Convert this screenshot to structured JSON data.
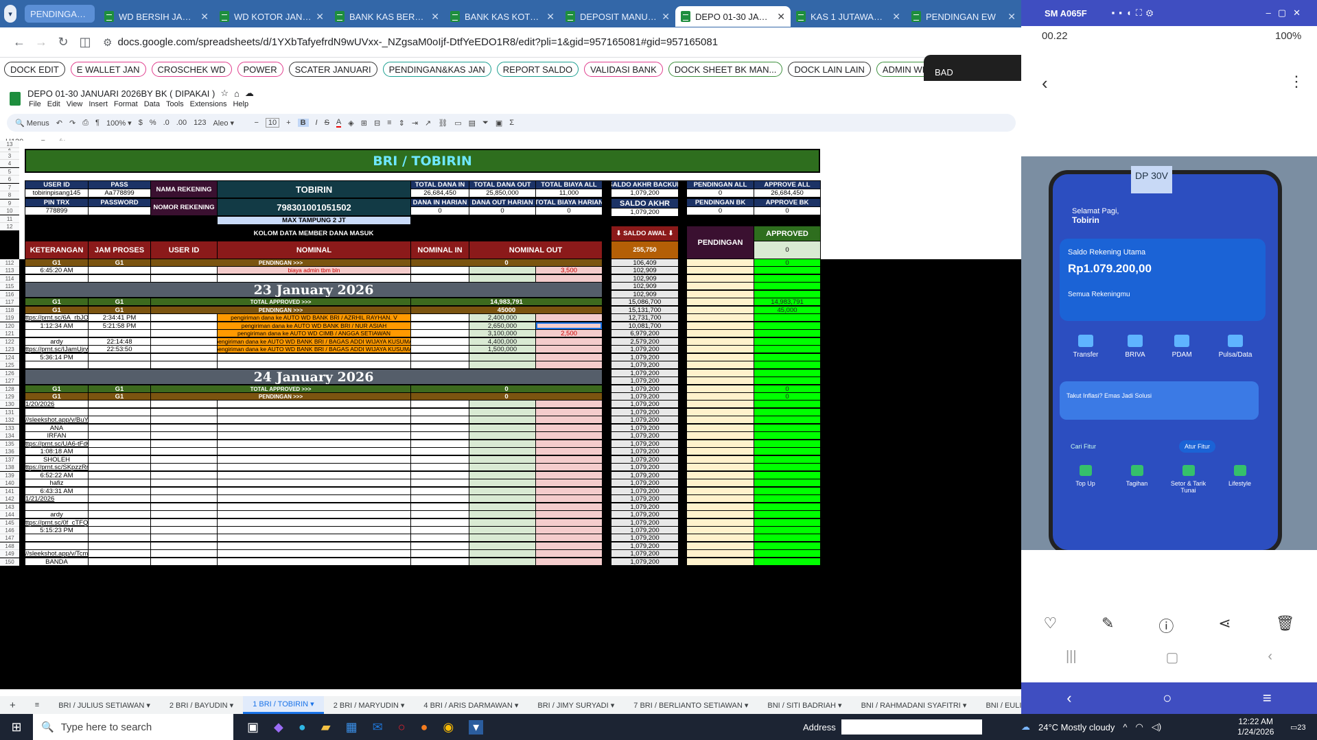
{
  "browser": {
    "pill_tab": "PENDINGAN&KAS JAN",
    "tabs": [
      "WD BERSIH JANUARI",
      "WD KOTOR JANUARI",
      "BANK KAS BERSIH",
      "BANK KAS KOTOR",
      "DEPOSIT MANUAL",
      "DEPO 01-30 JANUARI",
      "KAS 1 JUTAWAN JAN",
      "PENDINGAN EW"
    ],
    "url": "docs.google.com/spreadsheets/d/1YXbTafyefrdN9wUVxx-_NZgsaM0oIjf-DtfYeEDO1R8/edit?pli=1&gid=957165081#gid=957165081",
    "bookmarks": [
      "DOCK EDIT",
      "E WALLET JAN",
      "CROSCHEK WD",
      "POWER",
      "SCATER JANUARI",
      "PENDINGAN&KAS JAN",
      "REPORT SALDO",
      "VALIDASI BANK",
      "DOCK SHEET BK MAN...",
      "DOCK LAIN LAIN",
      "ADMIN WD DEPO"
    ],
    "bookmark_colors": [
      "#333333",
      "#e03c8c",
      "#e03c8c",
      "#e03c8c",
      "#333333",
      "#1a9e8f",
      "#1a9e8f",
      "#e03c8c",
      "#3c8f3c",
      "#333333",
      "#3c8f3c"
    ],
    "overlay": "BAD"
  },
  "doc": {
    "title": "DEPO 01-30 JANUARI  2026BY BK ( DIPAKAI )",
    "menus": [
      "File",
      "Edit",
      "View",
      "Insert",
      "Format",
      "Data",
      "Tools",
      "Extensions",
      "Help"
    ],
    "menus_label": "Menus",
    "zoom": "100%",
    "currency": "$",
    "percent": "%",
    "format123": "123",
    "font": "Aleo",
    "font_size": "10",
    "cell_ref": "H120",
    "fx": "fx"
  },
  "columns": [
    "A",
    "B",
    "C",
    "D",
    "E",
    "F",
    "G",
    "H",
    "I",
    "J",
    "K",
    "L",
    "M"
  ],
  "sheet": {
    "banner": "BRI / TOBIRIN",
    "info": {
      "user_id_h": "USER ID",
      "user_id": "tobirinpisang145",
      "pass_h": "PASS",
      "pass": "Aa778899",
      "pin_h": "PIN TRX",
      "pin": "778899",
      "password_h": "PASSWORD",
      "password": "",
      "nama_h": "NAMA REKENING",
      "nama": "TOBIRIN",
      "nomor_h": "NOMOR REKENING",
      "nomor": "79830100105150​2",
      "max": "MAX TAMPUNG 2 JT",
      "tdi_h": "TOTAL DANA IN",
      "tdi": "26,684,450",
      "tdo_h": "TOTAL DANA OUT",
      "tdo": "25,850,000",
      "tba_h": "TOTAL BIAYA ALL",
      "tba": "11,000",
      "dih_h": "DANA IN HARIAN",
      "dih": "0",
      "doh_h": "DANA OUT HARIAN",
      "doh": "0",
      "tbh_h": "TOTAL BIAYA HARIAN",
      "tbh": "0",
      "sab_h": "SALDO AKHR BACKUP",
      "sab": "1,079,200",
      "sa_h": "SALDO AKHR",
      "sa": "1,079,200",
      "pa_h": "PENDINGAN ALL",
      "pa": "0",
      "aa_h": "APPROVE ALL",
      "aa": "26,684,450",
      "pb_h": "PENDINGAN BK",
      "pb": "0",
      "ab_h": "APPROVE BK",
      "ab": "0"
    },
    "kolom": "KOLOM DATA MEMBER DANA MASUK",
    "headers": [
      "KETERANGAN",
      "JAM PROSES",
      "USER ID",
      "NOMINAL",
      "NOMINAL IN",
      "NOMINAL OUT"
    ],
    "saldo_awal_h": "⬇ SALDO AWAL ⬇",
    "saldo_awal": "255,750",
    "pendingan_h": "PENDINGAN",
    "approved_h": "APPROVED",
    "approved_v": "0",
    "date1": "23 January 2026",
    "date2": "24 January 2026",
    "g1": "G1",
    "total_approved": "TOTAL APPROVED >>>",
    "pendingan_lbl": "PENDINGAN >>>",
    "rows": [
      {
        "n": "112",
        "b": "G1",
        "c": "G1",
        "e": "PENDINGAN >>>",
        "g": "0",
        "j": "106,409",
        "m": "0",
        "t": "bro"
      },
      {
        "n": "113",
        "b": "6:45:20 AM",
        "e": "biaya admin tbm bln",
        "h": "3,500",
        "j": "102,909",
        "t": "n"
      },
      {
        "n": "114",
        "j": "102,909",
        "t": "n"
      },
      {
        "n": "115",
        "j": "102,909",
        "t": "d1"
      },
      {
        "n": "116",
        "j": "102,909",
        "t": "d1"
      },
      {
        "n": "117",
        "b": "G1",
        "c": "G1",
        "e": "TOTAL APPROVED >>>",
        "g": "14,983,791",
        "j": "15,086,700",
        "m": "14,983,791",
        "t": "grn"
      },
      {
        "n": "118",
        "b": "G1",
        "c": "G1",
        "e": "PENDINGAN >>>",
        "g": "45000",
        "j": "15,131,700",
        "m": "45,000",
        "t": "bro"
      },
      {
        "n": "119",
        "b": "ttps://prnt.sc/6A_rbJOcsH",
        "c": "2:34:41 PM",
        "e": "pengiriman dana ke AUTO WD BANK BRI / AZRHIL RAYHAN. V",
        "g": "2,400,000",
        "j": "12,731,700",
        "t": "o"
      },
      {
        "n": "120",
        "b": "1:12:34 AM",
        "c": "5:21:58 PM",
        "e": "pengiriman dana ke AUTO WD BANK BRI / NUR ASIAH",
        "g": "2,650,000",
        "j": "10,081,700",
        "t": "o"
      },
      {
        "n": "121",
        "e": "pengiriman dana ke AUTO WD CIMB / ANGGA SETIAWAN",
        "g": "3,100,000",
        "h": "2,500",
        "j": "6,979,200",
        "t": "o"
      },
      {
        "n": "122",
        "b": "ardy",
        "c": "22:14:48",
        "e": "pengiriman dana ke AUTO WD BANK BRI / BAGAS ADDI WIJAYA KUSUMA",
        "g": "4,400,000",
        "j": "2,579,200",
        "t": "o"
      },
      {
        "n": "123",
        "b": "ttps://prnt.sc/IJamUjrwtC",
        "c": "22:53:50",
        "e": "pengiriman dana ke AUTO WD BANK BRI / BAGAS ADDI WIJAYA KUSUMA",
        "g": "1,500,000",
        "j": "1,079,200",
        "t": "o"
      },
      {
        "n": "124",
        "b": "5:36:14 PM",
        "j": "1,079,200",
        "t": "n"
      },
      {
        "n": "125",
        "j": "1,079,200",
        "t": "n"
      },
      {
        "n": "126",
        "j": "1,079,200",
        "t": "d2"
      },
      {
        "n": "127",
        "j": "1,079,200",
        "t": "d2"
      },
      {
        "n": "128",
        "b": "G1",
        "c": "G1",
        "e": "TOTAL APPROVED >>>",
        "g": "0",
        "j": "1,079,200",
        "m": "0",
        "t": "grn"
      },
      {
        "n": "129",
        "b": "G1",
        "c": "G1",
        "e": "PENDINGAN >>>",
        "g": "0",
        "j": "1,079,200",
        "m": "0",
        "t": "bro"
      },
      {
        "n": "130",
        "b": "1/20/2026",
        "j": "1,079,200",
        "t": "n"
      },
      {
        "n": "131",
        "j": "1,079,200",
        "t": "n"
      },
      {
        "n": "132",
        "b": "//sleekshot.app/v/BuYJc6MLOdsB",
        "j": "1,079,200",
        "t": "n"
      },
      {
        "n": "133",
        "b": "ANA",
        "j": "1,079,200",
        "t": "n"
      },
      {
        "n": "134",
        "b": "IRFAN",
        "j": "1,079,200",
        "t": "n"
      },
      {
        "n": "135",
        "b": "ttps://prnt.sc/UA6-tFdwzz7A",
        "j": "1,079,200",
        "t": "n"
      },
      {
        "n": "136",
        "b": "1:08:18 AM",
        "j": "1,079,200",
        "t": "n"
      },
      {
        "n": "137",
        "b": "SHOLEH",
        "j": "1,079,200",
        "t": "n"
      },
      {
        "n": "138",
        "b": "ttps://prnt.sc/SKpzzRrJ4C5i",
        "j": "1,079,200",
        "t": "n"
      },
      {
        "n": "139",
        "b": "6:52:22 AM",
        "j": "1,079,200",
        "t": "n"
      },
      {
        "n": "140",
        "b": "hafiz",
        "j": "1,079,200",
        "t": "n"
      },
      {
        "n": "141",
        "b": "6:43:31 AM",
        "j": "1,079,200",
        "t": "n"
      },
      {
        "n": "142",
        "b": "1/21/2026",
        "j": "1,079,200",
        "t": "n"
      },
      {
        "n": "143",
        "j": "1,079,200",
        "t": "n"
      },
      {
        "n": "144",
        "b": "ardy",
        "j": "1,079,200",
        "t": "n"
      },
      {
        "n": "145",
        "b": "ttps://prnt.sc/0f_cTFQSdSiN",
        "j": "1,079,200",
        "t": "n"
      },
      {
        "n": "146",
        "b": "5:15:23 PM",
        "j": "1,079,200",
        "t": "n"
      },
      {
        "n": "147",
        "j": "1,079,200",
        "t": "n"
      },
      {
        "n": "148",
        "j": "1,079,200",
        "t": "n"
      },
      {
        "n": "149",
        "b": "//sleekshot.app/v/TcmiQX3esYKJ",
        "j": "1,079,200",
        "t": "n"
      },
      {
        "n": "150",
        "b": "BANDA",
        "j": "1,079,200",
        "t": "n"
      }
    ]
  },
  "sheet_tabs": [
    "BRI / JULIUS SETIAWAN",
    "2  BRI / BAYUDIN",
    "1  BRI / TOBIRIN",
    "2  BRI / MARYUDIN",
    "4  BRI / ARIS DARMAWAN",
    "BRI / JIMY SURYADI",
    "7  BRI / BERLIANTO SETIAWAN",
    "BNI / SITI BADRIAH",
    "BNI / RAHMADANI SYAFITRI",
    "BNI / EULIS RITA",
    "2  BRI / ASEP SU"
  ],
  "taskbar": {
    "search": "Type here to search",
    "address_label": "Address",
    "weather": "24°C  Mostly cloudy",
    "time": "12:22 AM",
    "date": "1/24/2026",
    "notif": "23"
  },
  "phone": {
    "window_title": "SM A065F",
    "status_time": "00.22",
    "battery": "100%",
    "app": {
      "greeting": "Selamat Pagi,",
      "name": "Tobirin",
      "saldo_label": "Saldo Rekening Utama",
      "saldo": "Rp1.079.200,00",
      "semua": "Semua Rekeningmu",
      "icons": [
        "Transfer",
        "BRIVA",
        "PDAM",
        "Pulsa/Data"
      ],
      "promo": "Takut Inflasi? Emas Jadi Solusi",
      "cari": "Cari Fitur",
      "atur": "Atur Fitur",
      "menu": [
        "Top Up",
        "Tagihan",
        "Setor & Tarik Tunai",
        "Lifestyle"
      ],
      "sticky": "DP 30V"
    }
  }
}
